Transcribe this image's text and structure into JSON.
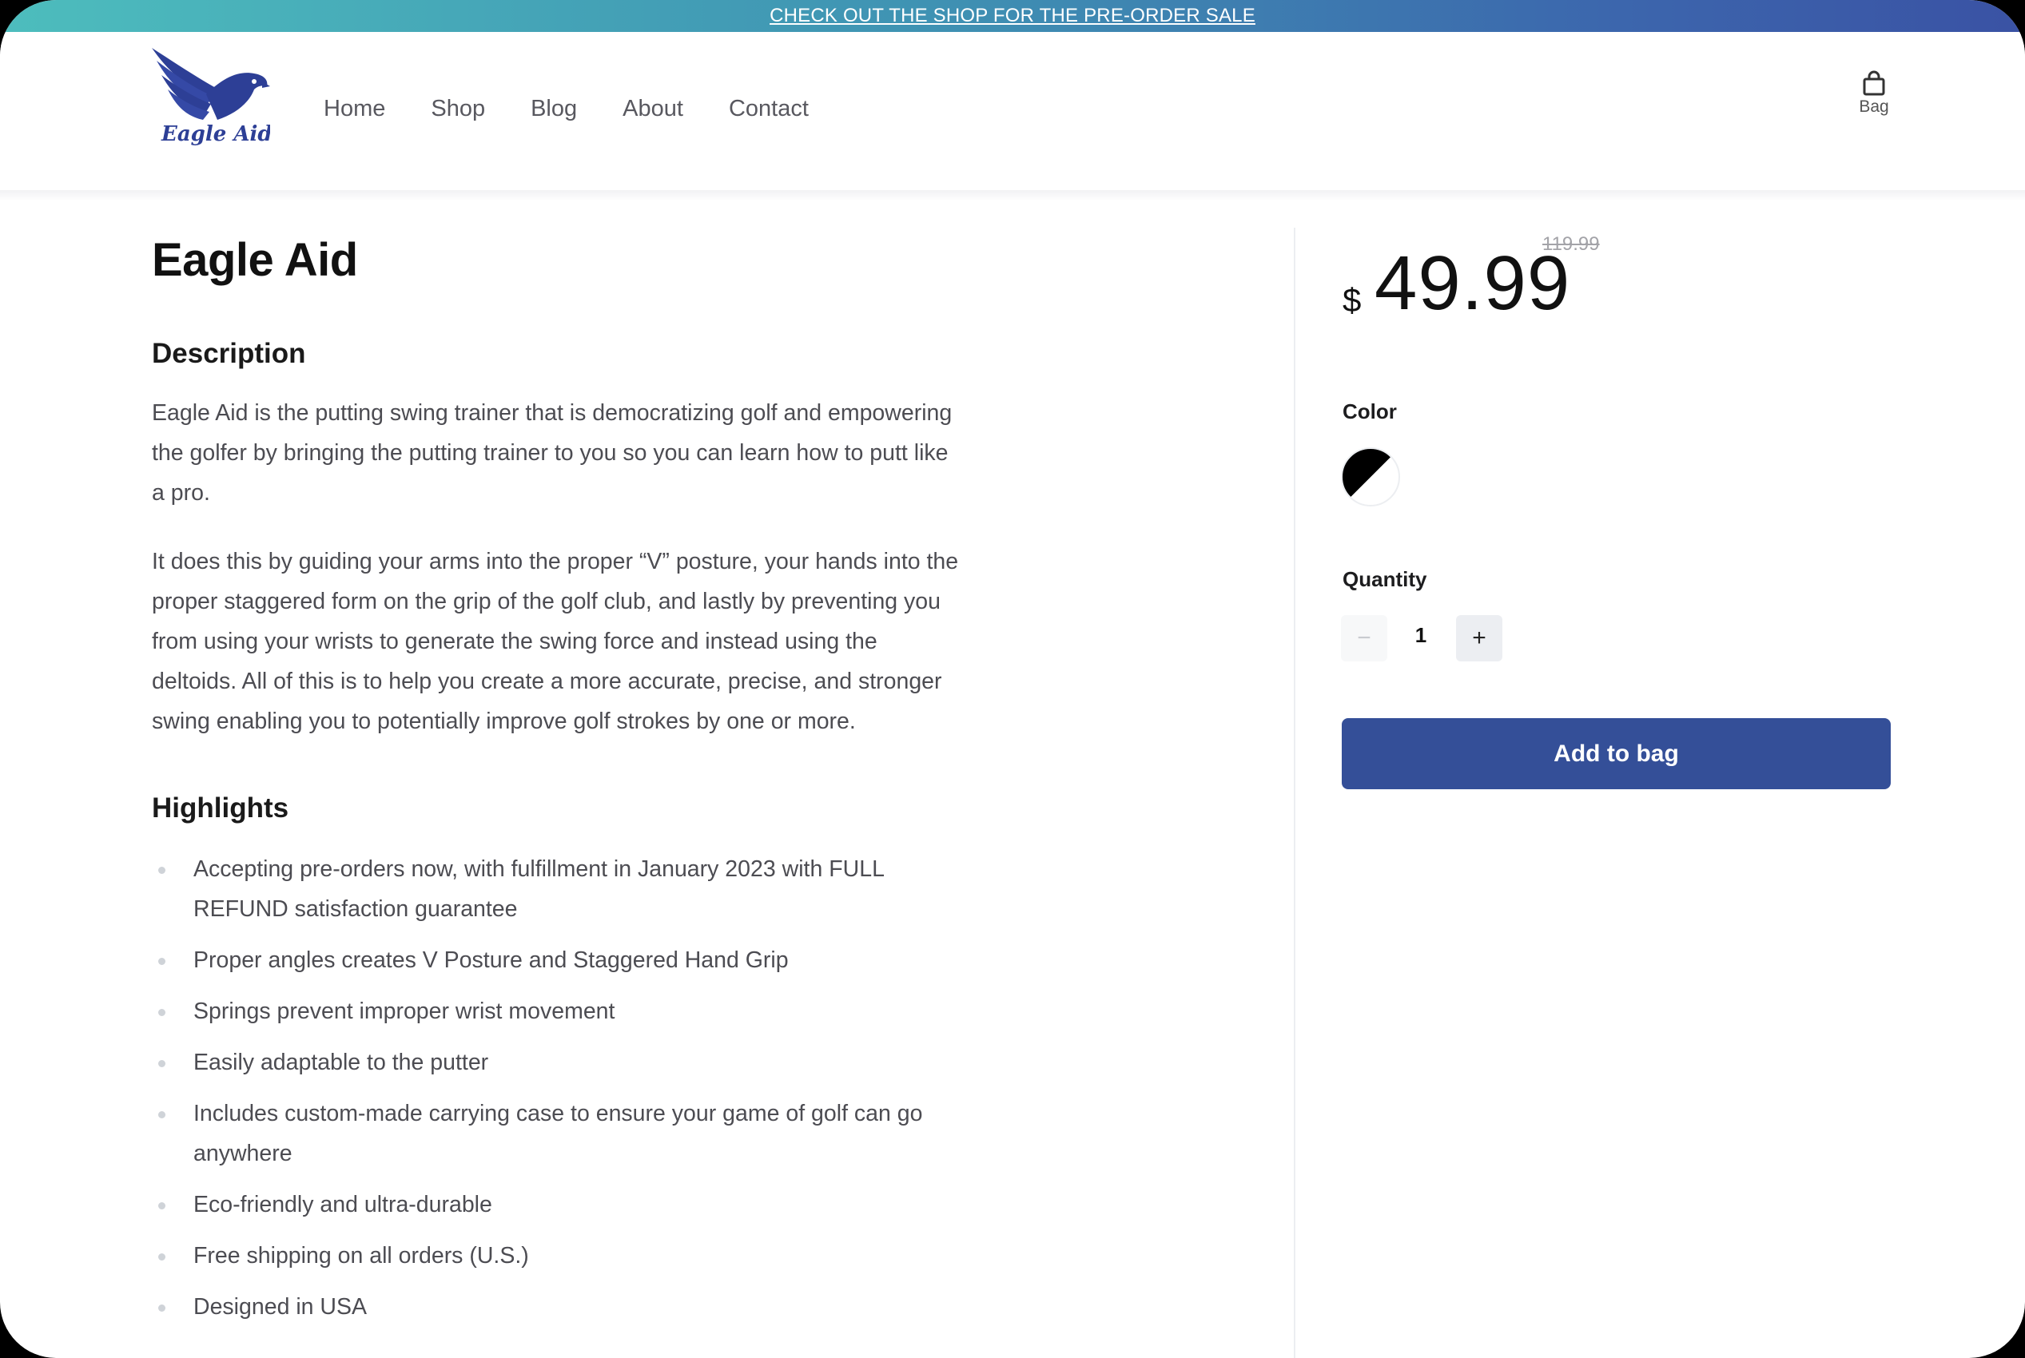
{
  "announcement": {
    "text": "CHECK OUT THE SHOP FOR THE PRE-ORDER SALE"
  },
  "header": {
    "logo_text": "Eagle Aid",
    "nav": [
      "Home",
      "Shop",
      "Blog",
      "About",
      "Contact"
    ],
    "bag_label": "Bag"
  },
  "product": {
    "title": "Eagle Aid",
    "description_heading": "Description",
    "description_paragraphs": [
      "Eagle Aid is the putting swing trainer that is democratizing golf and empowering the golfer by bringing the putting trainer to you so you can learn how to putt like a pro.",
      "It does this by guiding your arms into the proper “V” posture, your hands into the proper staggered form on the grip of the golf club, and lastly by preventing you from using your wrists to generate the swing force and instead using the deltoids. All of this is to help you create a more accurate, precise, and stronger swing enabling you to potentially improve golf strokes by one or more."
    ],
    "highlights_heading": "Highlights",
    "highlights": [
      "Accepting pre-orders now, with fulfillment in January 2023 with FULL REFUND satisfaction guarantee",
      "Proper angles creates V Posture and Staggered Hand Grip",
      "Springs prevent improper wrist movement",
      "Easily adaptable to the putter",
      "Includes custom-made carrying case to ensure your game of golf can go anywhere",
      "Eco-friendly and ultra-durable",
      "Free shipping on all orders (U.S.)",
      "Designed in USA"
    ]
  },
  "purchase": {
    "currency": "$",
    "price": "49.99",
    "old_price": "119.99",
    "color_label": "Color",
    "quantity_label": "Quantity",
    "quantity": "1",
    "minus": "−",
    "plus": "+",
    "add_to_bag": "Add to bag"
  },
  "colors": {
    "brand_blue": "#344f98",
    "announce_start": "#4dbdbd",
    "announce_end": "#3a52a4"
  }
}
